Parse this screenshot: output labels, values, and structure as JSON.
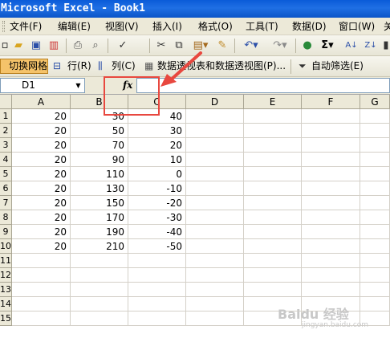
{
  "title": "Microsoft Excel - Book1",
  "menu": [
    "文件(F)",
    "编辑(E)",
    "视图(V)",
    "插入(I)",
    "格式(O)",
    "工具(T)",
    "数据(D)",
    "窗口(W)",
    "关"
  ],
  "toolbar2": {
    "toggle_grid": "切换网格",
    "row": "行(R)",
    "col": "列(C)",
    "pivot": "数据透视表和数据透视图(P)...",
    "autofilter": "自动筛选(E)"
  },
  "formula_bar": {
    "name_box": "D1",
    "fx": "fx",
    "formula": ""
  },
  "columns": [
    "A",
    "B",
    "C",
    "D",
    "E",
    "F",
    "G"
  ],
  "rows": [
    {
      "n": "1",
      "a": "20",
      "b": "30",
      "c": "40"
    },
    {
      "n": "2",
      "a": "20",
      "b": "50",
      "c": "30"
    },
    {
      "n": "3",
      "a": "20",
      "b": "70",
      "c": "20"
    },
    {
      "n": "4",
      "a": "20",
      "b": "90",
      "c": "10"
    },
    {
      "n": "5",
      "a": "20",
      "b": "110",
      "c": "0"
    },
    {
      "n": "6",
      "a": "20",
      "b": "130",
      "c": "-10"
    },
    {
      "n": "7",
      "a": "20",
      "b": "150",
      "c": "-20"
    },
    {
      "n": "8",
      "a": "20",
      "b": "170",
      "c": "-30"
    },
    {
      "n": "9",
      "a": "20",
      "b": "190",
      "c": "-40"
    },
    {
      "n": "10",
      "a": "20",
      "b": "210",
      "c": "-50"
    },
    {
      "n": "11",
      "a": "",
      "b": "",
      "c": ""
    },
    {
      "n": "12",
      "a": "",
      "b": "",
      "c": ""
    },
    {
      "n": "13",
      "a": "",
      "b": "",
      "c": ""
    },
    {
      "n": "14",
      "a": "",
      "b": "",
      "c": ""
    },
    {
      "n": "15",
      "a": "",
      "b": "",
      "c": ""
    }
  ],
  "watermark": {
    "main": "Baidu 经验",
    "sub": "jingyan.baidu.com"
  },
  "colors": {
    "title": "#0a5bd8",
    "highlight": "#e8483f",
    "chrome": "#ece9d8"
  }
}
